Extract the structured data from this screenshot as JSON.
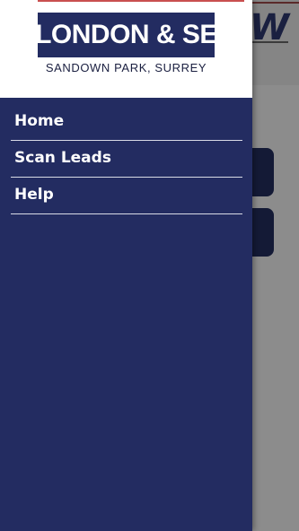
{
  "background": {
    "title": "W"
  },
  "drawer": {
    "logo": {
      "title": "LONDON & SE",
      "subtitle": "SANDOWN PARK, SURREY"
    },
    "menu": [
      {
        "label": "Home"
      },
      {
        "label": "Scan Leads"
      },
      {
        "label": "Help"
      }
    ]
  },
  "colors": {
    "brand_navy": "#232c61",
    "accent_red": "#c94f4f",
    "overlay_gray": "#8a8a8a"
  }
}
